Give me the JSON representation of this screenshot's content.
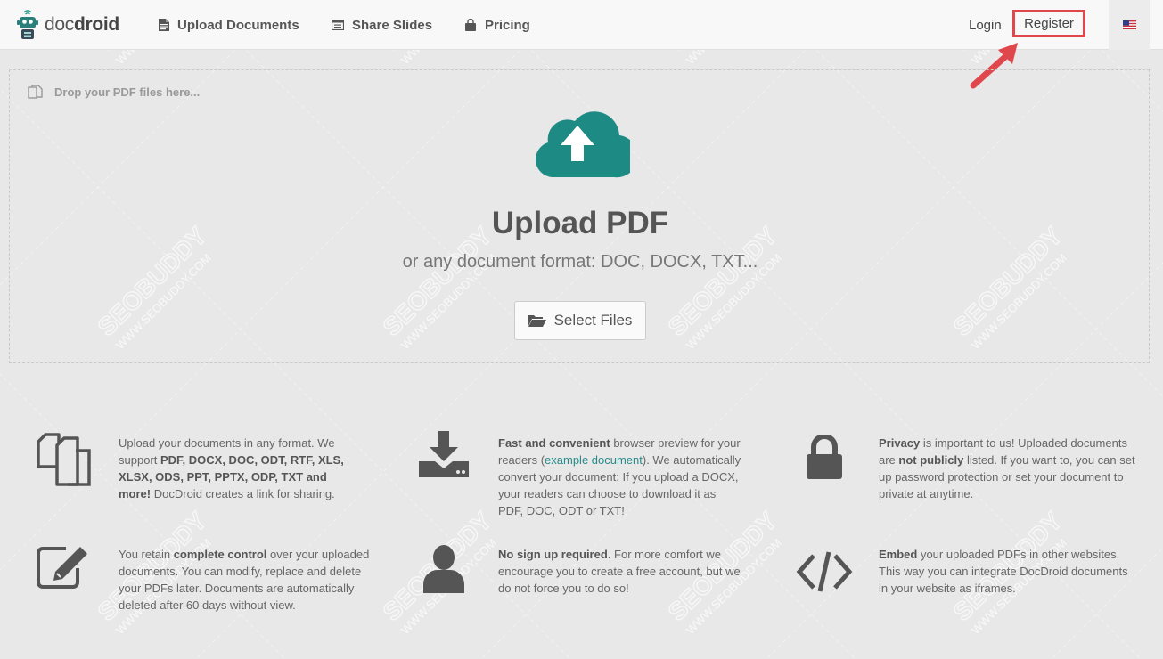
{
  "header": {
    "brand_prefix": "doc",
    "brand_suffix": "droid",
    "nav": [
      {
        "label": "Upload Documents",
        "icon": "file-icon"
      },
      {
        "label": "Share Slides",
        "icon": "slides-icon"
      },
      {
        "label": "Pricing",
        "icon": "bag-icon"
      }
    ],
    "login_label": "Login",
    "register_label": "Register",
    "language_icon": "us-flag-icon"
  },
  "dropzone": {
    "hint": "Drop your PDF files here...",
    "title": "Upload PDF",
    "subtitle": "or any document format: DOC, DOCX, TXT...",
    "select_label": "Select Files"
  },
  "features": [
    {
      "icon": "files-icon",
      "parts": [
        {
          "t": "Upload your documents in any format. We support "
        },
        {
          "t": "PDF, DOCX, DOC, ODT, RTF, XLS, XLSX, ODS, PPT, PPTX, ODP, TXT and more!",
          "b": true
        },
        {
          "t": " DocDroid creates a link for sharing."
        }
      ]
    },
    {
      "icon": "download-icon",
      "parts": [
        {
          "t": "Fast and convenient",
          "b": true
        },
        {
          "t": " browser preview for your readers ("
        },
        {
          "t": "example document",
          "link": true
        },
        {
          "t": "). We automatically convert your document: If you upload a DOCX, your readers can choose to download it as PDF, DOC, ODT or TXT!"
        }
      ]
    },
    {
      "icon": "lock-icon",
      "parts": [
        {
          "t": "Privacy",
          "b": true
        },
        {
          "t": " is important to us! Uploaded documents are "
        },
        {
          "t": "not publicly",
          "b": true
        },
        {
          "t": " listed. If you want to, you can set up password protection or set your document to private at anytime."
        }
      ]
    },
    {
      "icon": "edit-icon",
      "parts": [
        {
          "t": "You retain "
        },
        {
          "t": "complete control",
          "b": true
        },
        {
          "t": " over your uploaded documents. You can modify, replace and delete your PDFs later. Documents are automatically deleted after 60 days without view."
        }
      ]
    },
    {
      "icon": "user-icon",
      "parts": [
        {
          "t": "No sign up required",
          "b": true
        },
        {
          "t": ". For more comfort we encourage you to create a free account, but we do not force you to do so!"
        }
      ]
    },
    {
      "icon": "code-icon",
      "parts": [
        {
          "t": "Embed",
          "b": true
        },
        {
          "t": " your uploaded PDFs in other websites. This way you can integrate DocDroid documents in your website as iframes."
        }
      ]
    }
  ],
  "colors": {
    "accent": "#1e8a84",
    "highlight": "#e0474c"
  },
  "watermark": {
    "big": "SEOBUDDY",
    "small": "WWW.SEOBUDDY.COM"
  }
}
